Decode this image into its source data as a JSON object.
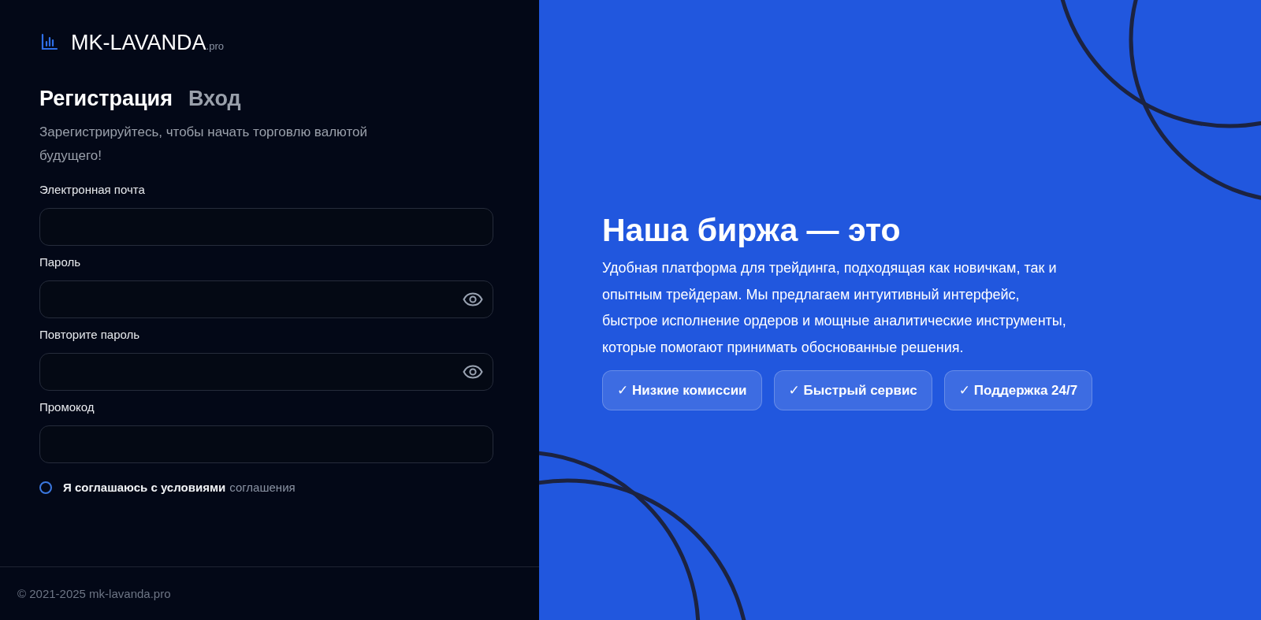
{
  "logo": {
    "name": "MK-LAVANDA",
    "suffix": ".pro"
  },
  "tabs": [
    {
      "label": "Регистрация",
      "selected": true
    },
    {
      "label": "Вход",
      "selected": false
    }
  ],
  "subtitle": "Зарегистрируйтесь, чтобы начать торговлю валютой будущего!",
  "fields": [
    {
      "label": "Электронная почта",
      "kind": "text"
    },
    {
      "label": "Пароль",
      "kind": "password"
    },
    {
      "label": "Повторите пароль",
      "kind": "password"
    },
    {
      "label": "Промокод",
      "kind": "text"
    }
  ],
  "agreement": {
    "text": "Я соглашаюсь с условиями",
    "link": "соглашения",
    "checked": false
  },
  "footer": "© 2021-2025 mk-lavanda.pro",
  "promo": {
    "title": "Наша биржа — это",
    "text": "Удобная платформа для трейдинга, подходящая как новичкам, так и опытным трейдерам. Мы предлагаем интуитивный интерфейс, быстрое исполнение ордеров и мощные аналитические инструменты, которые помогают принимать обоснованные решения.",
    "features": [
      "✓ Низкие комиссии",
      "✓ Быстрый сервис",
      "✓ Поддержка 24/7"
    ]
  }
}
